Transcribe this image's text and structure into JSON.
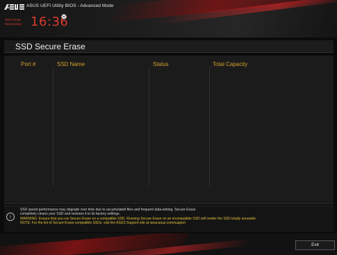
{
  "header": {
    "title": "ASUS UEFI Utility BIOS - Advanced Mode",
    "date": "06/27/2016",
    "weekday": "Wednesday",
    "time": "16:36",
    "settings_icon": "gear-icon"
  },
  "page": {
    "title": "SSD Secure Erase"
  },
  "table": {
    "columns": [
      "Port #",
      "SSD Name",
      "Status",
      "Total Capacity"
    ],
    "rows": []
  },
  "info": {
    "icon": "info-icon",
    "line1": "SSD speed performance may degrade over time due to accumulated files and frequent data-writing. Secure Erase",
    "line2": "completely cleans your SSD and restores it to its factory settings.",
    "warning": "WARNING: Ensure that you run Secure Erase on a compatible SSD. Running Secure Erase on an incompatible SSD will render the SSD totally unusable.",
    "note": "NOTE: For the list of Secure Erase-compatible SSDs, visit the ASUS Support site at www.asus.com/support"
  },
  "footer": {
    "exit_label": "Exit"
  },
  "colors": {
    "accent_red": "#d93a2e",
    "column_header": "#d3a12b",
    "warning_text": "#e3c13a"
  }
}
